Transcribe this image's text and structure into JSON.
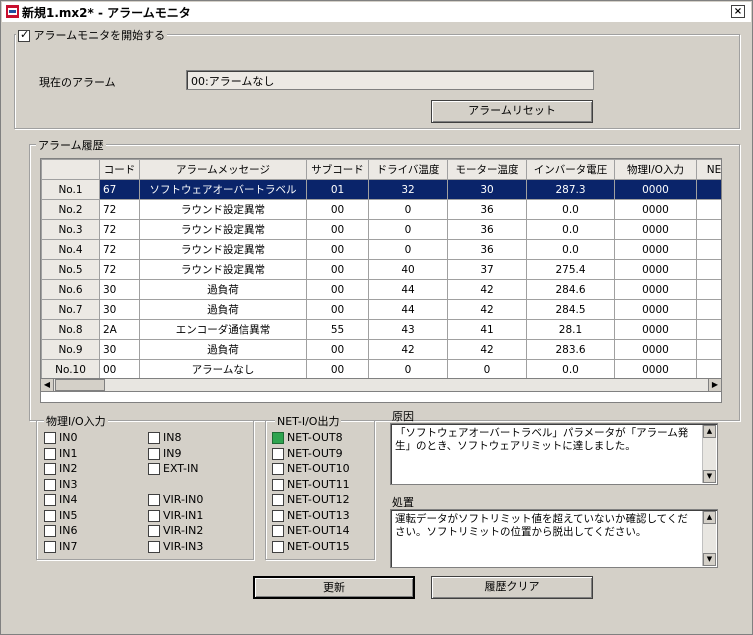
{
  "window": {
    "title": "新規1.mx2* - アラームモニタ",
    "close": "×"
  },
  "monitor": {
    "checkbox_label": "アラームモニタを開始する",
    "checked": true,
    "current_alarm_label": "現在のアラーム",
    "current_alarm_value": "00:アラームなし",
    "reset_button": "アラームリセット"
  },
  "history": {
    "legend": "アラーム履歴",
    "columns": [
      "",
      "コード",
      "アラームメッセージ",
      "サブコード",
      "ドライバ温度",
      "モーター温度",
      "インバータ電圧",
      "物理I/O入力",
      "NE"
    ],
    "rows": [
      {
        "no": "No.1",
        "code": "67",
        "message": "ソフトウェアオーバートラベル",
        "sub": "01",
        "driver": "32",
        "motor": "30",
        "inverter": "287.3",
        "io": "0000",
        "selected": true
      },
      {
        "no": "No.2",
        "code": "72",
        "message": "ラウンド設定異常",
        "sub": "00",
        "driver": "0",
        "motor": "36",
        "inverter": "0.0",
        "io": "0000"
      },
      {
        "no": "No.3",
        "code": "72",
        "message": "ラウンド設定異常",
        "sub": "00",
        "driver": "0",
        "motor": "36",
        "inverter": "0.0",
        "io": "0000"
      },
      {
        "no": "No.4",
        "code": "72",
        "message": "ラウンド設定異常",
        "sub": "00",
        "driver": "0",
        "motor": "36",
        "inverter": "0.0",
        "io": "0000"
      },
      {
        "no": "No.5",
        "code": "72",
        "message": "ラウンド設定異常",
        "sub": "00",
        "driver": "40",
        "motor": "37",
        "inverter": "275.4",
        "io": "0000"
      },
      {
        "no": "No.6",
        "code": "30",
        "message": "過負荷",
        "sub": "00",
        "driver": "44",
        "motor": "42",
        "inverter": "284.6",
        "io": "0000"
      },
      {
        "no": "No.7",
        "code": "30",
        "message": "過負荷",
        "sub": "00",
        "driver": "44",
        "motor": "42",
        "inverter": "284.5",
        "io": "0000"
      },
      {
        "no": "No.8",
        "code": "2A",
        "message": "エンコーダ通信異常",
        "sub": "55",
        "driver": "43",
        "motor": "41",
        "inverter": "28.1",
        "io": "0000"
      },
      {
        "no": "No.9",
        "code": "30",
        "message": "過負荷",
        "sub": "00",
        "driver": "42",
        "motor": "42",
        "inverter": "283.6",
        "io": "0000"
      },
      {
        "no": "No.10",
        "code": "00",
        "message": "アラームなし",
        "sub": "00",
        "driver": "0",
        "motor": "0",
        "inverter": "0.0",
        "io": "0000"
      }
    ]
  },
  "physical_io": {
    "legend": "物理I/O入力",
    "col1": [
      "IN0",
      "IN1",
      "IN2",
      "IN3",
      "IN4",
      "IN5",
      "IN6",
      "IN7"
    ],
    "col2": [
      "IN8",
      "IN9",
      "EXT-IN",
      "",
      "VIR-IN0",
      "VIR-IN1",
      "VIR-IN2",
      "VIR-IN3"
    ]
  },
  "net_io": {
    "legend": "NET-I/O出力",
    "items": [
      "NET-OUT8",
      "NET-OUT9",
      "NET-OUT10",
      "NET-OUT11",
      "NET-OUT12",
      "NET-OUT13",
      "NET-OUT14",
      "NET-OUT15"
    ],
    "active_index": 0,
    "active_color": "#2ea44f"
  },
  "cause": {
    "label": "原因",
    "text": "「ソフトウェアオーバートラベル」パラメータが「アラーム発生」のとき、ソフトウェアリミットに達しました。"
  },
  "remedy": {
    "label": "処置",
    "text": "運転データがソフトリミット値を超えていないか確認してください。ソフトリミットの位置から脱出してください。"
  },
  "buttons": {
    "update": "更新",
    "clear_history": "履歴クリア"
  },
  "colors": {
    "selection": "#0a246a",
    "window_bg": "#d4d0c8"
  }
}
